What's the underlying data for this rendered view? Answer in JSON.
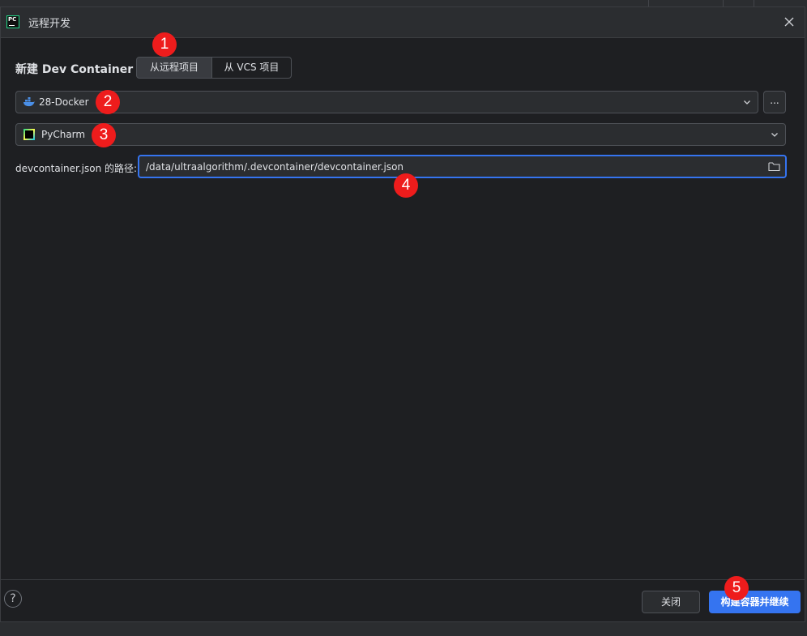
{
  "window": {
    "title": "远程开发",
    "app_icon_text": "PC",
    "close_icon": "close-icon"
  },
  "header": {
    "title": "新建 Dev Container",
    "tabs": [
      {
        "label": "从远程项目",
        "selected": true
      },
      {
        "label": "从 VCS 项目",
        "selected": false
      }
    ]
  },
  "host_select": {
    "value": "28-Docker",
    "icon": "docker-icon"
  },
  "more_button": {
    "label": "..."
  },
  "ide_select": {
    "value": "PyCharm",
    "icon": "pycharm-icon"
  },
  "path_field": {
    "label": "devcontainer.json 的路径:",
    "value": "/data/ultraalgorithm/.devcontainer/devcontainer.json",
    "icon": "folder-icon"
  },
  "footer": {
    "help_label": "?",
    "close_label": "关闭",
    "primary_label": "构建容器并继续"
  },
  "annotations": [
    "1",
    "2",
    "3",
    "4",
    "5"
  ],
  "colors": {
    "accent": "#3574f0",
    "badge": "#ee1c1c",
    "background": "#1e1f22"
  }
}
